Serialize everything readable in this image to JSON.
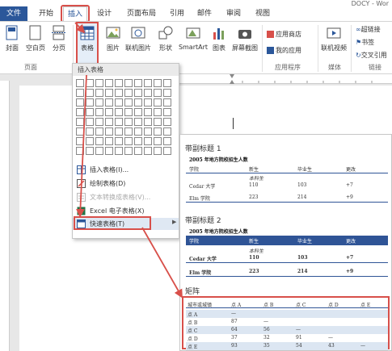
{
  "title_snippet": "DOCY - Wor",
  "tabs": [
    "文件",
    "开始",
    "插入",
    "设计",
    "页面布局",
    "引用",
    "邮件",
    "审阅",
    "视图"
  ],
  "ribbon": {
    "cover": "封面",
    "blank_page": "空白页",
    "page_break": "分页",
    "table": "表格",
    "picture": "图片",
    "online_picture": "联机图片",
    "shapes": "形状",
    "smartart": "SmartArt",
    "chart": "图表",
    "screenshot": "屏幕截图",
    "app_store": "应用商店",
    "my_apps": "我的应用",
    "online_video": "联机视频",
    "hyperlink": "超链接",
    "bookmark": "书签",
    "cross_ref": "交叉引用",
    "groups": {
      "pages": "页面",
      "apps": "应用程序",
      "media": "媒体",
      "links": "链接"
    }
  },
  "dropdown": {
    "header": "插入表格",
    "items": [
      {
        "label": "插入表格(I)...",
        "disabled": false
      },
      {
        "label": "绘制表格(D)",
        "disabled": false
      },
      {
        "label": "文本转换成表格(V)...",
        "disabled": true
      },
      {
        "label": "Excel 电子表格(X)",
        "disabled": false
      },
      {
        "label": "快速表格(T)",
        "disabled": false
      }
    ]
  },
  "gallery": {
    "sections": [
      {
        "title": "带副标题 1",
        "caption": "2005 年地方院校招生人数",
        "header": [
          "学院",
          "新生",
          "毕业生",
          "更改"
        ],
        "subheader": "本科生",
        "rows": [
          [
            "Cedar 大学",
            "110",
            "103",
            "+7"
          ],
          [
            "Elm 学院",
            "223",
            "214",
            "+9"
          ]
        ]
      },
      {
        "title": "带副标题 2",
        "caption": "2005 年地方院校招生人数",
        "header": [
          "学院",
          "新生",
          "毕业生",
          "更改"
        ],
        "subheader": "本科生",
        "rows": [
          [
            "Cedar 大学",
            "110",
            "103",
            "+7"
          ],
          [
            "Elm 学院",
            "223",
            "214",
            "+9"
          ]
        ]
      }
    ],
    "matrix": {
      "title": "矩阵",
      "header": [
        "城市或城镇",
        "点 A",
        "点 B",
        "点 C",
        "点 D",
        "点 E"
      ],
      "rows": [
        [
          "点 A",
          "—",
          "",
          "",
          "",
          ""
        ],
        [
          "点 B",
          "87",
          "—",
          "",
          "",
          ""
        ],
        [
          "点 C",
          "64",
          "56",
          "—",
          "",
          ""
        ],
        [
          "点 D",
          "37",
          "32",
          "91",
          "—",
          ""
        ],
        [
          "点 E",
          "93",
          "35",
          "54",
          "43",
          "—"
        ]
      ]
    }
  },
  "colors": {
    "accent": "#2b579a",
    "highlight": "#d8504a",
    "table_header": "#2f5496"
  }
}
